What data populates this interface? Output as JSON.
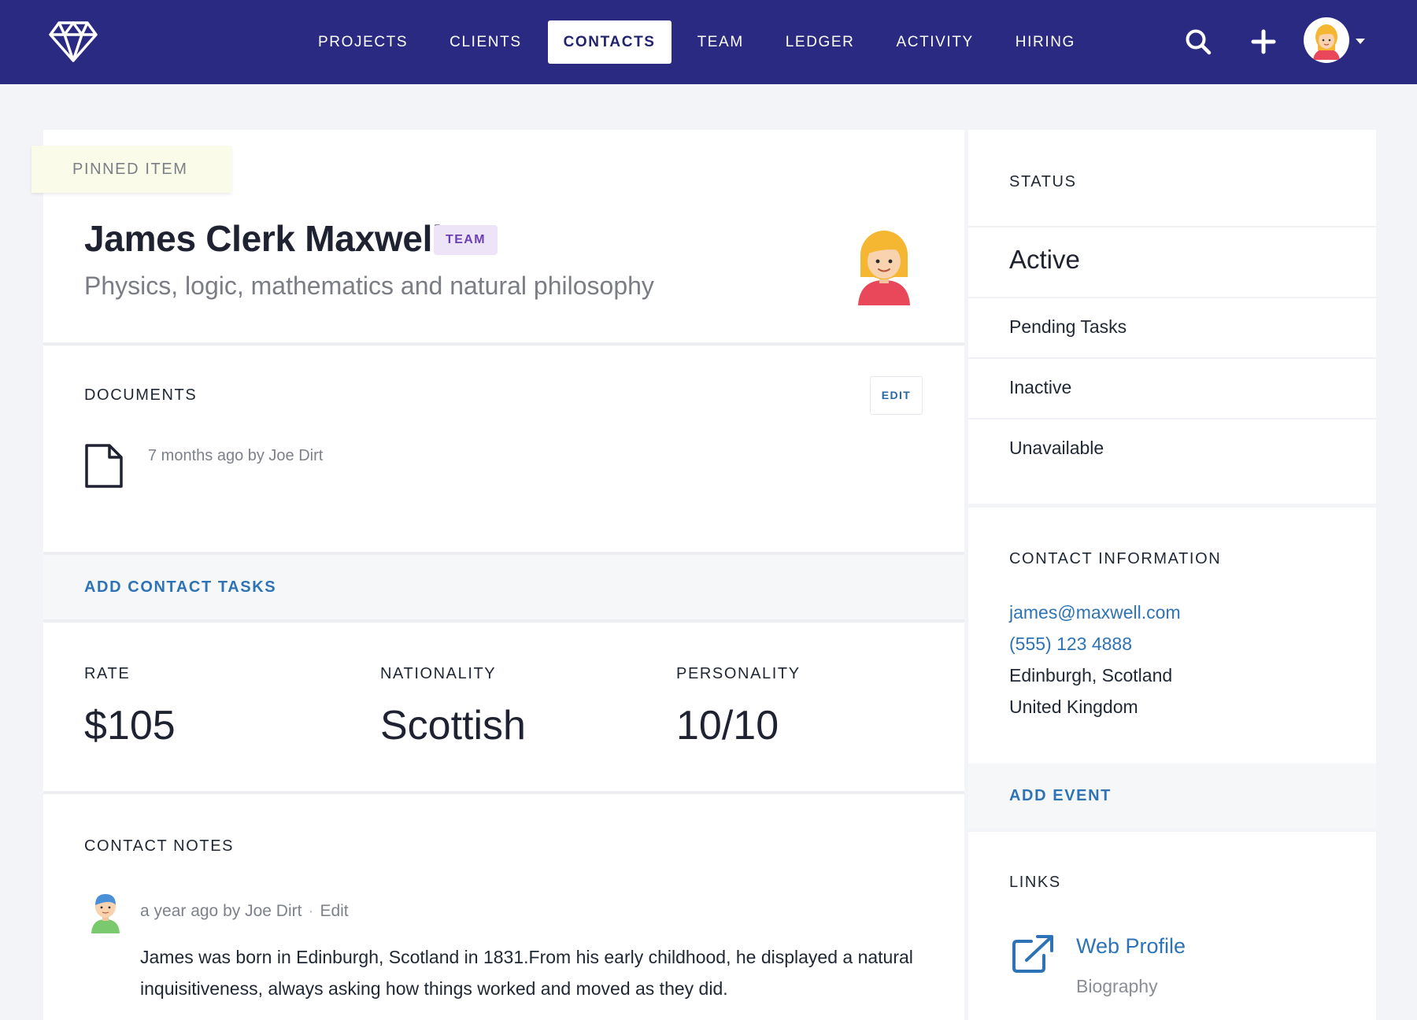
{
  "nav": {
    "items": [
      {
        "label": "PROJECTS"
      },
      {
        "label": "CLIENTS"
      },
      {
        "label": "CONTACTS"
      },
      {
        "label": "TEAM"
      },
      {
        "label": "LEDGER"
      },
      {
        "label": "ACTIVITY"
      },
      {
        "label": "HIRING"
      }
    ],
    "active": "CONTACTS",
    "icons": [
      "diamond-logo-icon",
      "search-icon",
      "plus-icon",
      "user-avatar",
      "chevron-down-icon"
    ]
  },
  "pinned_label": "PINNED ITEM",
  "profile": {
    "name": "James Clerk Maxwell",
    "badge": "TEAM",
    "subtitle": "Physics, logic, mathematics and natural philosophy"
  },
  "documents": {
    "heading": "DOCUMENTS",
    "edit_label": "EDIT",
    "meta": "7 months ago by Joe Dirt"
  },
  "add_contact_tasks": "ADD CONTACT TASKS",
  "stats": [
    {
      "label": "RATE",
      "value": "$105"
    },
    {
      "label": "NATIONALITY",
      "value": "Scottish"
    },
    {
      "label": "PERSONALITY",
      "value": "10/10"
    }
  ],
  "notes": {
    "heading": "CONTACT NOTES",
    "meta": "a year ago by Joe Dirt",
    "separator": "·",
    "edit_label": "Edit",
    "body": "James was born in Edinburgh, Scotland in 1831.From his early childhood, he displayed a natural inquisitiveness, always asking how things worked and moved as they did."
  },
  "status": {
    "heading": "STATUS",
    "options": [
      "Active",
      "Pending Tasks",
      "Inactive",
      "Unavailable"
    ],
    "selected": "Active"
  },
  "contact_info": {
    "heading": "CONTACT INFORMATION",
    "email": "james@maxwell.com",
    "phone": "(555) 123 4888",
    "city": "Edinburgh, Scotland",
    "country": "United Kingdom"
  },
  "add_event": "ADD EVENT",
  "links": {
    "heading": "LINKS",
    "title": "Web Profile",
    "subtitle": "Biography"
  },
  "colors": {
    "nav_bg": "#2b2a82",
    "link": "#2e73b5",
    "badge_bg": "#ede4f8",
    "badge_text": "#6b3fb4",
    "pinned_bg": "#fbfbe9"
  }
}
